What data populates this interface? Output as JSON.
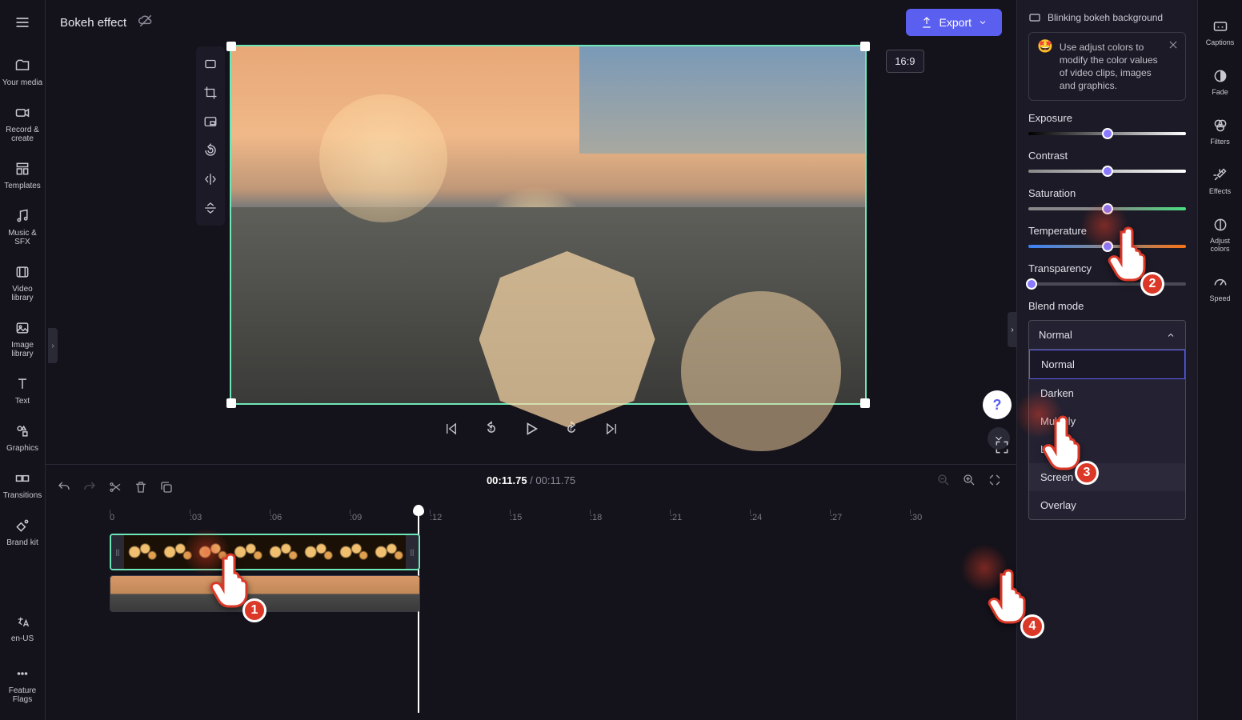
{
  "topbar": {
    "project_title": "Bokeh effect",
    "export_label": "Export",
    "ratio_label": "16:9"
  },
  "left_nav": {
    "items": [
      {
        "label": "Your media"
      },
      {
        "label": "Record & create"
      },
      {
        "label": "Templates"
      },
      {
        "label": "Music & SFX"
      },
      {
        "label": "Video library"
      },
      {
        "label": "Image library"
      },
      {
        "label": "Text"
      },
      {
        "label": "Graphics"
      },
      {
        "label": "Transitions"
      },
      {
        "label": "Brand kit"
      }
    ],
    "bottom": {
      "locale": "en-US",
      "flags": "Feature Flags"
    }
  },
  "far_right": {
    "items": [
      {
        "label": "Captions"
      },
      {
        "label": "Fade"
      },
      {
        "label": "Filters"
      },
      {
        "label": "Effects"
      },
      {
        "label": "Adjust colors"
      },
      {
        "label": "Speed"
      }
    ]
  },
  "playback": {
    "current": "00:11.75",
    "total": "00:11.75"
  },
  "timeline": {
    "ticks": [
      "0",
      ":03",
      ":06",
      ":09",
      ":12",
      ":15",
      ":18",
      ":21",
      ":24",
      ":27",
      ":30"
    ]
  },
  "panel": {
    "clip_name": "Blinking bokeh background",
    "tip": "Use adjust colors to modify the color values of video clips, images and graphics.",
    "props": {
      "exposure": "Exposure",
      "contrast": "Contrast",
      "saturation": "Saturation",
      "temperature": "Temperature",
      "transparency": "Transparency",
      "blend": "Blend mode"
    },
    "slider_pos": {
      "exposure": 50,
      "contrast": 50,
      "saturation": 50,
      "temperature": 50,
      "transparency": 2
    },
    "blend_selected": "Normal",
    "blend_options": [
      "Normal",
      "Darken",
      "Multiply",
      "Lighten",
      "Screen",
      "Overlay"
    ]
  },
  "pointers": {
    "p1": "1",
    "p2": "2",
    "p3": "3",
    "p4": "4"
  },
  "colors": {
    "accent": "#5b5fef",
    "selection": "#6ee7b7",
    "pointer": "#dc3828"
  }
}
